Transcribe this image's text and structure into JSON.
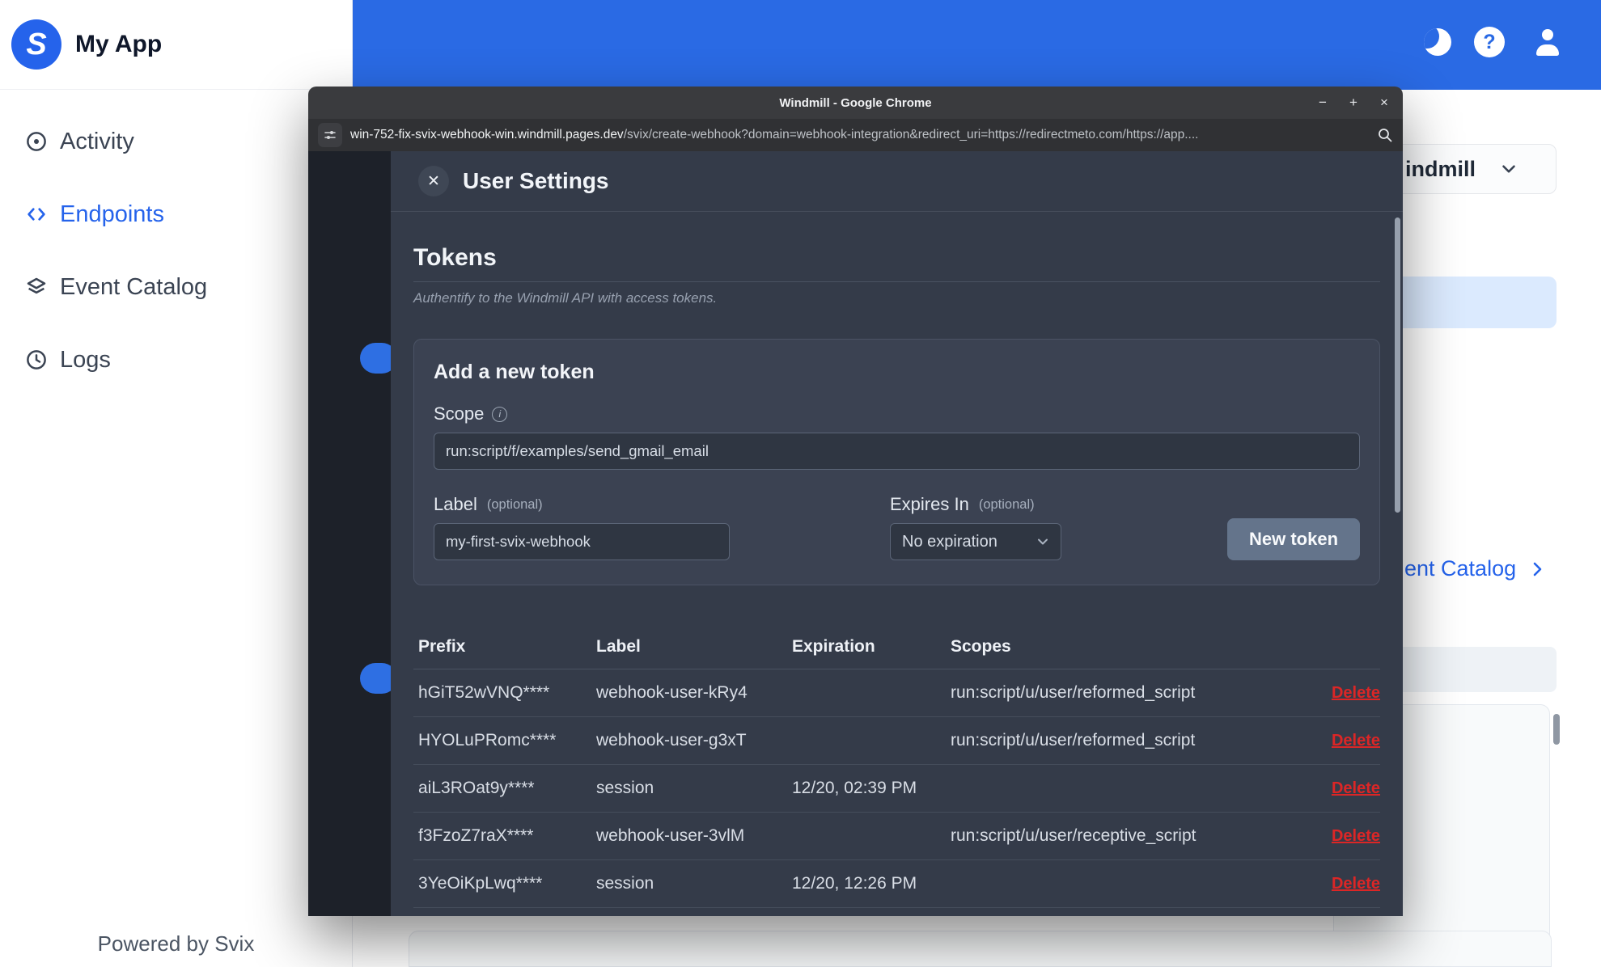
{
  "colors": {
    "brand_blue": "#2a6ae4",
    "link_blue": "#2563eb",
    "modal_bg": "#343b49",
    "card_bg": "#3b4252",
    "button_slate": "#64748b",
    "delete_red": "#dc2626",
    "banner_light_blue": "#dbeafe"
  },
  "icons": {
    "help_glyph": "?"
  },
  "app": {
    "title": "My App",
    "logo_letter": "S",
    "sidebar": {
      "items": [
        {
          "label": "Activity"
        },
        {
          "label": "Endpoints"
        },
        {
          "label": "Event Catalog"
        },
        {
          "label": "Logs"
        }
      ],
      "footer": "Powered by Svix"
    },
    "background_page": {
      "dropdown_label": "indmill",
      "catalog_link": "ent Catalog"
    }
  },
  "browser": {
    "window_title": "Windmill - Google Chrome",
    "controls": {
      "minimize": "−",
      "maximize": "+",
      "close": "×"
    },
    "url_host": "win-752-fix-svix-webhook-win.windmill.pages.dev",
    "url_path": "/svix/create-webhook?domain=webhook-integration&redirect_uri=https://redirectmeto.com/https://app...."
  },
  "modal": {
    "title": "User Settings",
    "close_symbol": "✕",
    "tokens_heading": "Tokens",
    "tokens_subtitle": "Authentify to the Windmill API with access tokens.",
    "add_token": {
      "heading": "Add a new token",
      "scope_label": "Scope",
      "scope_value": "run:script/f/examples/send_gmail_email",
      "label_label": "Label",
      "optional_hint": "(optional)",
      "label_value": "my-first-svix-webhook",
      "expires_label": "Expires In",
      "expires_value": "No expiration",
      "submit_label": "New token"
    },
    "table": {
      "headers": [
        "Prefix",
        "Label",
        "Expiration",
        "Scopes"
      ],
      "delete_label": "Delete",
      "rows": [
        {
          "prefix": "hGiT52wVNQ****",
          "label": "webhook-user-kRy4",
          "expiration": "",
          "scopes": "run:script/u/user/reformed_script"
        },
        {
          "prefix": "HYOLuPRomc****",
          "label": "webhook-user-g3xT",
          "expiration": "",
          "scopes": "run:script/u/user/reformed_script"
        },
        {
          "prefix": "aiL3ROat9y****",
          "label": "session",
          "expiration": "12/20, 02:39 PM",
          "scopes": ""
        },
        {
          "prefix": "f3FzoZ7raX****",
          "label": "webhook-user-3vlM",
          "expiration": "",
          "scopes": "run:script/u/user/receptive_script"
        },
        {
          "prefix": "3YeOiKpLwq****",
          "label": "session",
          "expiration": "12/20, 12:26 PM",
          "scopes": ""
        }
      ]
    }
  }
}
